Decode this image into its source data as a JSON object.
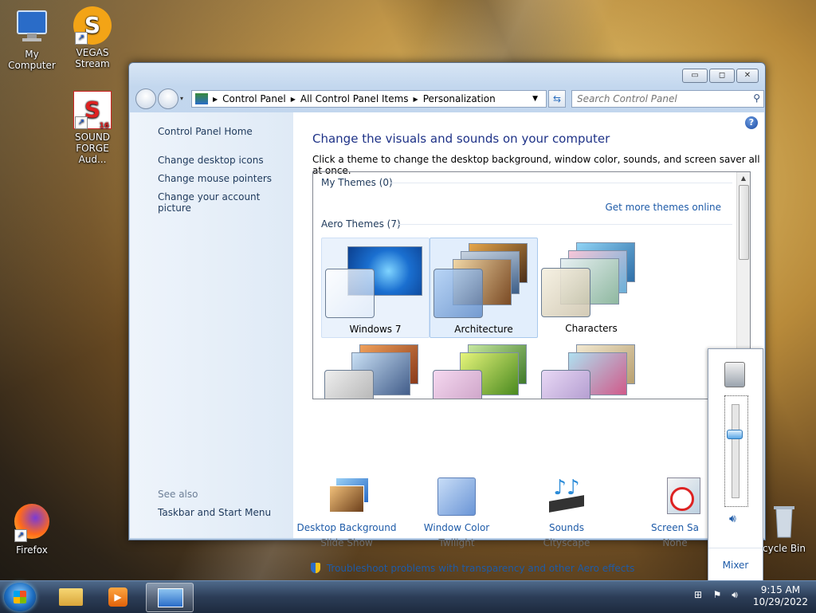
{
  "desktop": {
    "icons": [
      {
        "label": "My Computer"
      },
      {
        "label": "VEGAS\nStream",
        "glyph": "S"
      },
      {
        "label": "SOUND\nFORGE Aud...",
        "glyph": "S",
        "badge": "16"
      },
      {
        "label": "Firefox"
      },
      {
        "label": "cycle Bin"
      }
    ]
  },
  "window": {
    "buttons": {
      "minimize": "▭",
      "maximize": "◻",
      "close": "✕"
    },
    "breadcrumb": [
      "Control Panel",
      "All Control Panel Items",
      "Personalization"
    ],
    "search_placeholder": "Search Control Panel",
    "help_glyph": "?",
    "left_nav": {
      "home": "Control Panel Home",
      "links": [
        "Change desktop icons",
        "Change mouse pointers",
        "Change your account picture"
      ],
      "see_also_label": "See also",
      "see_also_links": [
        "Taskbar and Start Menu"
      ]
    },
    "title": "Change the visuals and sounds on your computer",
    "subtitle": "Click a theme to change the desktop background, window color, sounds, and screen saver all at once.",
    "my_themes": "My Themes (0)",
    "get_more": "Get more themes online",
    "aero_themes": "Aero Themes (7)",
    "themes": [
      {
        "name": "Windows 7",
        "selected": false,
        "hover": true
      },
      {
        "name": "Architecture",
        "selected": true
      },
      {
        "name": "Characters",
        "selected": false
      }
    ],
    "bottom": [
      {
        "name": "Desktop Background",
        "value": "Slide Show"
      },
      {
        "name": "Window Color",
        "value": "Twilight"
      },
      {
        "name": "Sounds",
        "value": "Cityscape"
      },
      {
        "name": "Screen Sa",
        "value": "None"
      }
    ],
    "troubleshoot": "Troubleshoot problems with transparency and other Aero effects"
  },
  "volume": {
    "mixer": "Mixer",
    "level": 0.7
  },
  "taskbar": {
    "time": "9:15 AM",
    "date": "10/29/2022"
  },
  "colors": {
    "link": "#1e5ba8",
    "title": "#1e3287",
    "selection": "#e2eefc"
  }
}
